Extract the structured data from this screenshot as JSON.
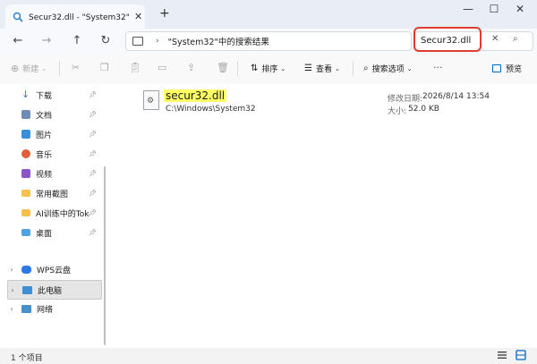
{
  "window": {
    "tab_title": "Secur32.dll - \"System32\"中的搜",
    "tab_close": "✕",
    "new_tab": "+",
    "minimize": "—",
    "maximize": "☐",
    "close": "✕"
  },
  "nav": {
    "back": "←",
    "forward": "→",
    "up": "↑",
    "refresh": "↻"
  },
  "address": {
    "separator": "›",
    "breadcrumb": "\"System32\"中的搜索结果"
  },
  "search": {
    "value": "Secur32.dll",
    "clear": "✕",
    "icon": "⌕"
  },
  "toolbar": {
    "new_label": "新建",
    "sort_label": "排序",
    "view_label": "查看",
    "search_options_label": "搜索选项",
    "preview_label": "预览"
  },
  "sidebar": {
    "quick_access": [
      {
        "label": "下载",
        "color": "#2b7cd3"
      },
      {
        "label": "文档",
        "color": "#6e8fb5"
      },
      {
        "label": "图片",
        "color": "#3a8fd8"
      },
      {
        "label": "音乐",
        "color": "#e0603a"
      },
      {
        "label": "视频",
        "color": "#8a55c9"
      },
      {
        "label": "常用截图",
        "color": "#f2c14e"
      },
      {
        "label": "AI训练中的Toke",
        "color": "#f2c14e"
      },
      {
        "label": "桌面",
        "color": "#4fa3e0"
      }
    ],
    "tree": [
      {
        "label": "WPS云盘",
        "color": "#2c7be5"
      },
      {
        "label": "此电脑",
        "color": "#3a8fd8"
      },
      {
        "label": "网络",
        "color": "#4a90c8"
      }
    ]
  },
  "file": {
    "name": "secur32.dll",
    "path": "C:\\Windows\\System32",
    "modified_label": "修改日期:",
    "modified_value": "2026/8/14 13:54",
    "size_label": "大小:",
    "size_value": "52.0 KB"
  },
  "status": {
    "item_count": "1 个项目"
  },
  "colors": {
    "accent": "#0067c0",
    "highlight": "#ffff66",
    "callout": "#e23b30"
  }
}
